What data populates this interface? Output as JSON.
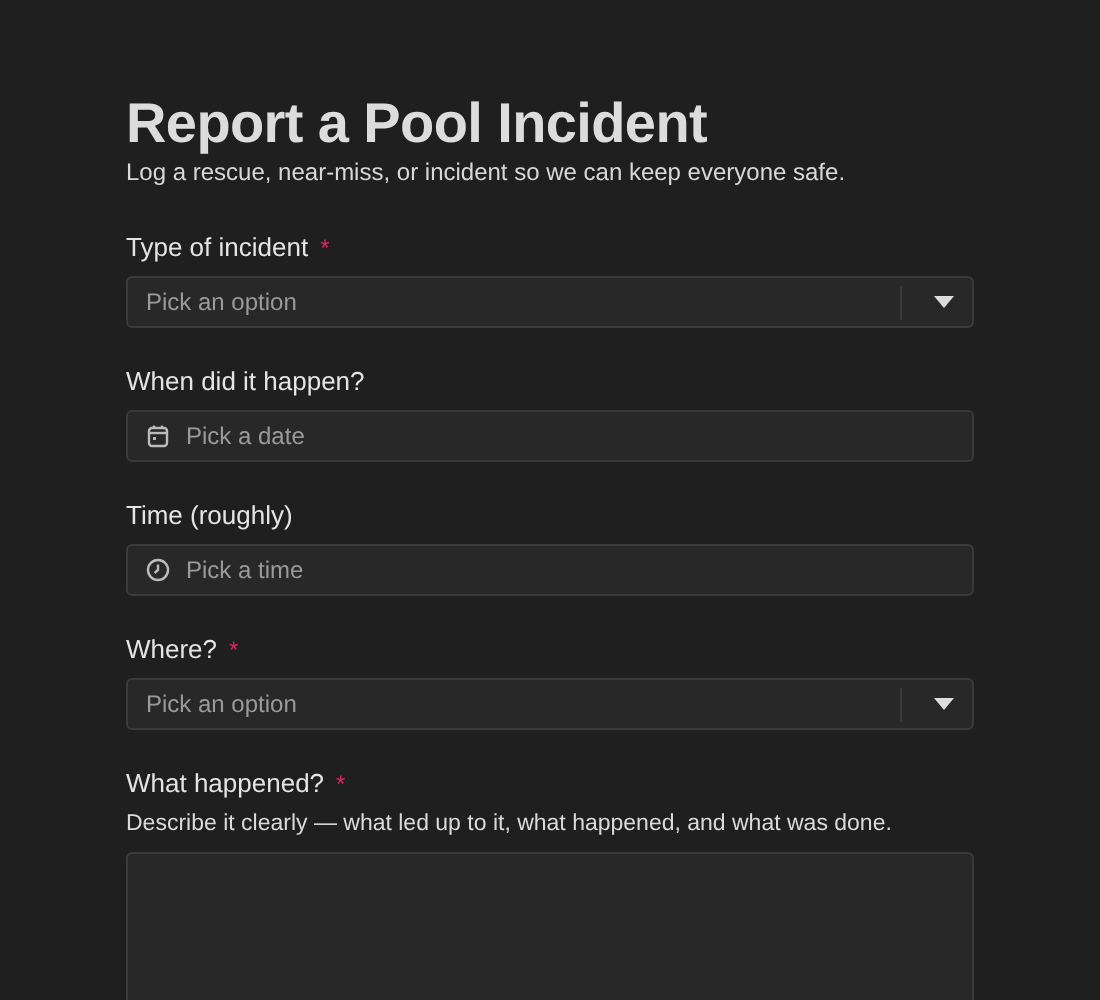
{
  "title": "Report a Pool Incident",
  "subtitle": "Log a rescue, near-miss, or incident so we can keep everyone safe.",
  "fields": [
    {
      "kind": "select",
      "label": "Type of incident",
      "marker": "*",
      "placeholder": "Pick an option"
    },
    {
      "kind": "date",
      "label": "When did it happen?",
      "placeholder": "Pick a date"
    },
    {
      "kind": "time",
      "label": "Time (roughly)",
      "placeholder": "Pick a time"
    },
    {
      "kind": "select",
      "label": "Where?",
      "marker": "*",
      "placeholder": "Pick an option"
    },
    {
      "kind": "textarea",
      "label": "What happened?",
      "marker": "*",
      "hint": "Describe it clearly — what led up to it, what happened, and what was done."
    }
  ]
}
